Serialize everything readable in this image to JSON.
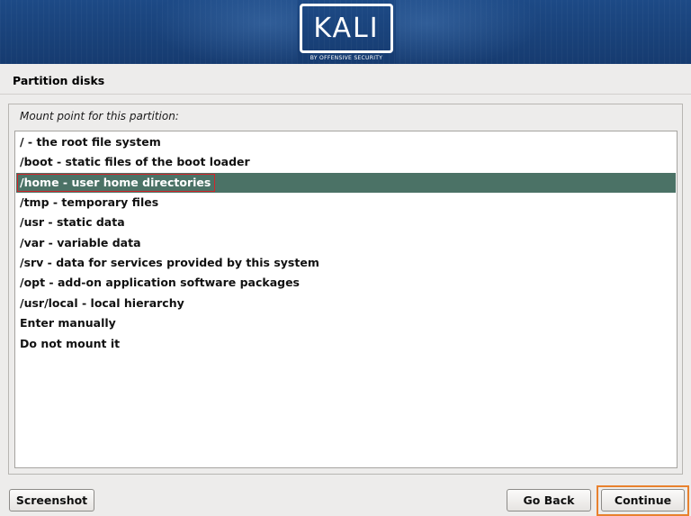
{
  "header": {
    "logo_text": "KALI",
    "logo_subtitle": "BY OFFENSIVE SECURITY"
  },
  "page": {
    "title": "Partition disks",
    "prompt": "Mount point for this partition:"
  },
  "options": [
    {
      "label": "/ - the root file system"
    },
    {
      "label": "/boot - static files of the boot loader"
    },
    {
      "label": "/home - user home directories"
    },
    {
      "label": "/tmp - temporary files"
    },
    {
      "label": "/usr - static data"
    },
    {
      "label": "/var - variable data"
    },
    {
      "label": "/srv - data for services provided by this system"
    },
    {
      "label": "/opt - add-on application software packages"
    },
    {
      "label": "/usr/local - local hierarchy"
    },
    {
      "label": "Enter manually"
    },
    {
      "label": "Do not mount it"
    }
  ],
  "selected_option": "/home - user home directories",
  "buttons": {
    "screenshot": "Screenshot",
    "go_back": "Go Back",
    "continue": "Continue"
  },
  "colors": {
    "banner": "#1d4a86",
    "selection": "#4b7266",
    "annotation_highlight": "#d5242a",
    "focus_ring": "#e8812e"
  }
}
